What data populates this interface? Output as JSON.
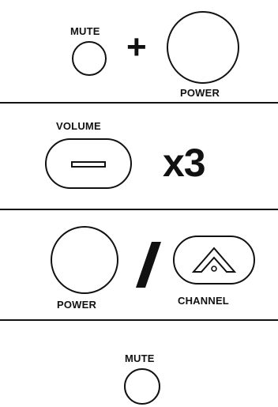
{
  "step1": {
    "mute_label": "MUTE",
    "plus_symbol": "+",
    "power_label": "POWER"
  },
  "step2": {
    "volume_label": "VOLUME",
    "multiplier": "x3"
  },
  "step3": {
    "power_label": "POWER",
    "separator": "/",
    "channel_label": "CHANNEL"
  },
  "step4": {
    "mute_label": "MUTE"
  },
  "icons": {
    "volume_down": "minus-bar-icon",
    "channel_up": "chevron-up-icon"
  }
}
